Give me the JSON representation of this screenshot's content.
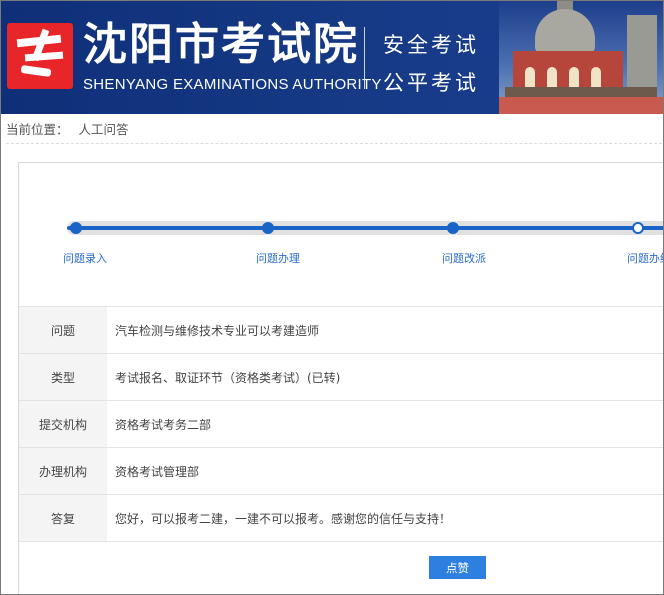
{
  "header": {
    "logo_char": "考",
    "title_cn": "沈阳市考试院",
    "title_en": "SHENYANG EXAMINATIONS AUTHORITY",
    "slogan_1": "安全考试",
    "slogan_2": "公平考试"
  },
  "breadcrumb": {
    "label": "当前位置：",
    "current": "人工问答"
  },
  "progress": {
    "steps": [
      {
        "label": "问题录入",
        "state": "done"
      },
      {
        "label": "问题办理",
        "state": "done"
      },
      {
        "label": "问题改派",
        "state": "done"
      },
      {
        "label": "问题办结",
        "state": "current"
      }
    ],
    "color": "#1a64c8"
  },
  "details": [
    {
      "key": "问题",
      "value": "汽车检测与维修技术专业可以考建造师"
    },
    {
      "key": "类型",
      "value": "考试报名、取证环节（资格类考试）(已转)"
    },
    {
      "key": "提交机构",
      "value": "资格考试考务二部"
    },
    {
      "key": "办理机构",
      "value": "资格考试管理部"
    },
    {
      "key": "答复",
      "value": "您好，可以报考二建，一建不可以报考。感谢您的信任与支持！"
    }
  ],
  "actions": {
    "like_label": "点赞"
  },
  "colors": {
    "banner": "#163a86",
    "accent": "#2d7fe0",
    "logo": "#e8262a"
  }
}
